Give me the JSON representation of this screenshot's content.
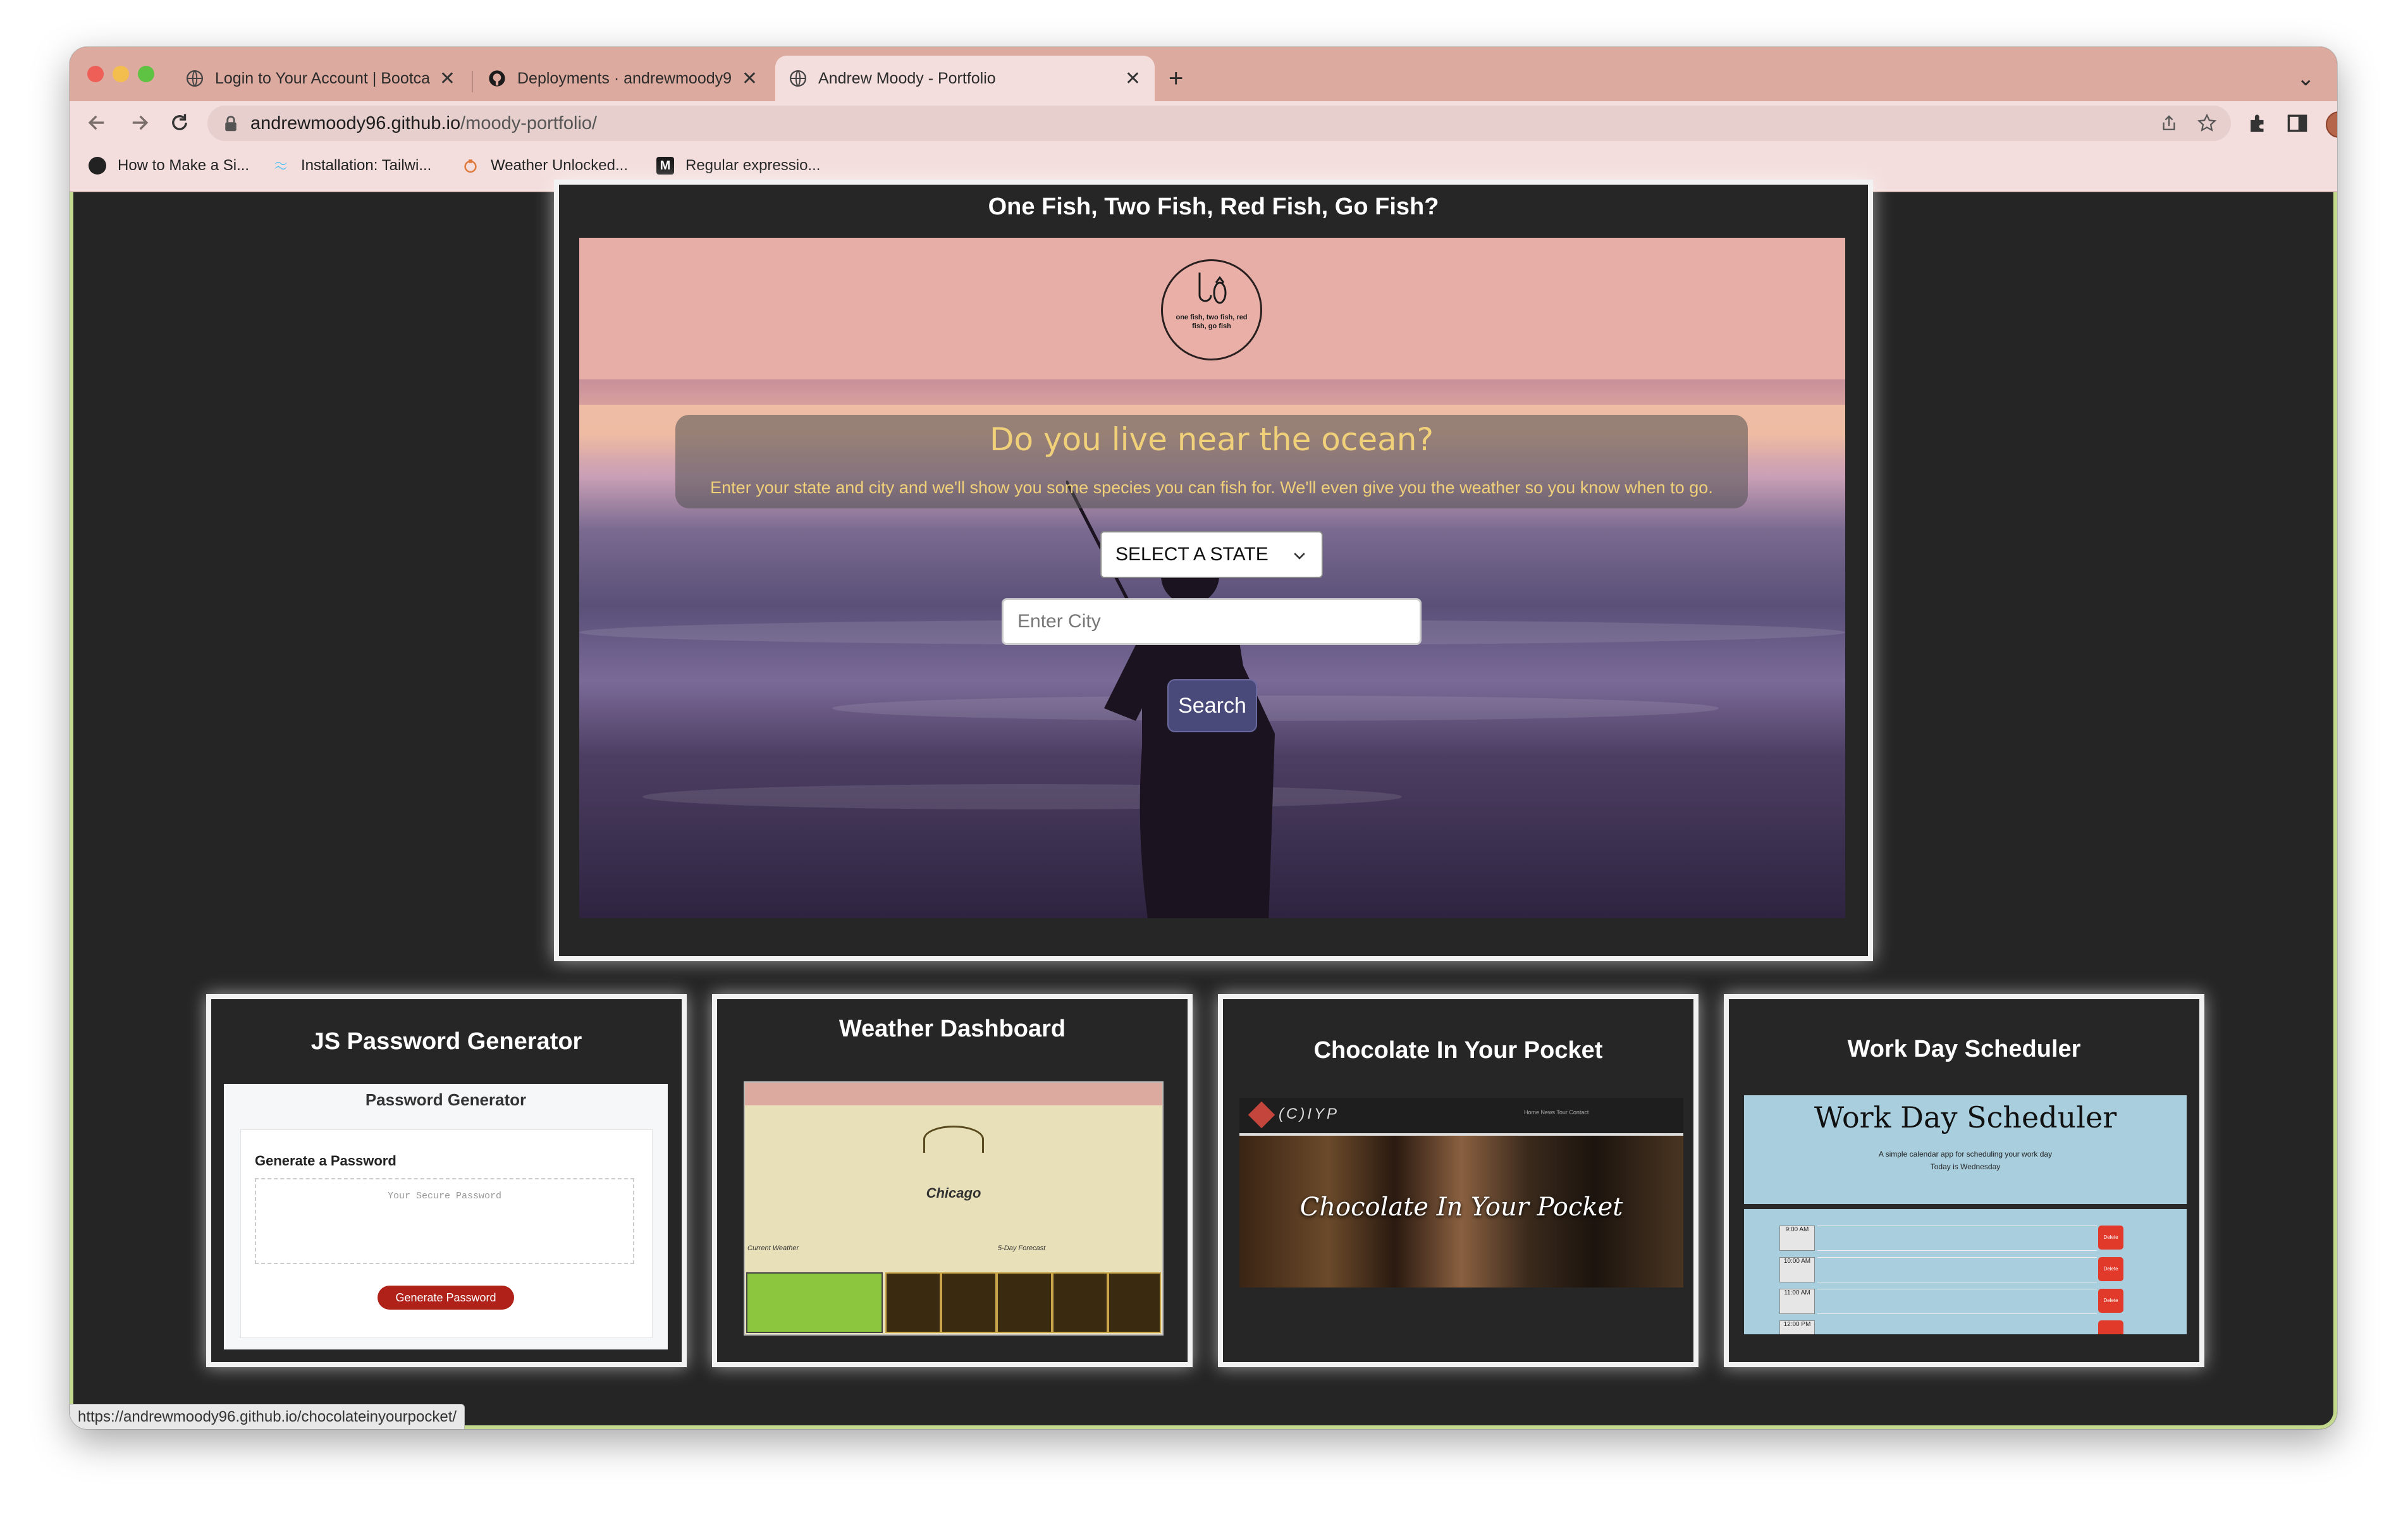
{
  "browser": {
    "tabs": [
      {
        "title": "Login to Your Account | Bootca",
        "active": false
      },
      {
        "title": "Deployments · andrewmoody9",
        "active": false
      },
      {
        "title": "Andrew Moody - Portfolio",
        "active": true
      }
    ],
    "close_glyph": "✕",
    "new_tab_glyph": "+",
    "tab_menu_glyph": "⌄",
    "url_host": "andrewmoody96.github.io",
    "url_path": "/moody-portfolio/",
    "bookmarks": [
      {
        "label": "How to Make a Si...",
        "icon": "site-icon"
      },
      {
        "label": "Installation: Tailwi...",
        "icon": "tailwind-icon"
      },
      {
        "label": "Weather Unlocked...",
        "icon": "weather-icon"
      },
      {
        "label": "Regular expressio...",
        "icon": "m-icon"
      }
    ],
    "status_url": "https://andrewmoody96.github.io/chocolateinyourpocket/"
  },
  "featured": {
    "title": "One Fish, Two Fish, Red Fish, Go Fish?",
    "logo_text": "one fish, two fish, red fish, go fish",
    "heading": "Do you live near the ocean?",
    "subheading": "Enter your state and city and we'll show you some species you can fish for. We'll even give you the weather so you know when to go.",
    "state_select": "SELECT A STATE",
    "city_placeholder": "Enter City",
    "search_label": "Search"
  },
  "projects": [
    {
      "title": "JS Password Generator",
      "shot": {
        "heading": "Password Generator",
        "subheading": "Generate a Password",
        "placeholder": "Your Secure Password",
        "button": "Generate Password"
      }
    },
    {
      "title": "Weather Dashboard",
      "shot": {
        "city": "Chicago",
        "current": "Current Weather",
        "forecast": "5-Day Forecast"
      }
    },
    {
      "title": "Chocolate In Your Pocket",
      "shot": {
        "brand": "(C)IYP",
        "hero": "Chocolate In Your Pocket",
        "nav": "Home   News   Tour   Contact"
      }
    },
    {
      "title": "Work Day Scheduler",
      "shot": {
        "heading": "Work Day Scheduler",
        "line1": "A simple calendar app for scheduling your work day",
        "line2": "Today is Wednesday",
        "hours": [
          "9:00 AM",
          "10:00 AM",
          "11:00 AM",
          "12:00 PM"
        ],
        "delete": "Delete"
      }
    }
  ]
}
